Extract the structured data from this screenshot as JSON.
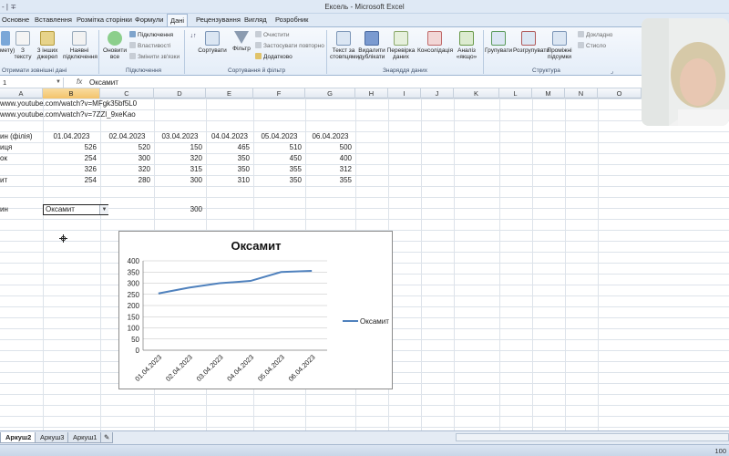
{
  "window": {
    "title": "Ексель - Microsoft Excel",
    "qat": "- | ∓"
  },
  "tabs": [
    "Основне",
    "Вставлення",
    "Розмітка сторінки",
    "Формули",
    "Дані",
    "Рецензування",
    "Вигляд",
    "Розробник"
  ],
  "ribbon": {
    "get_external": {
      "item1": "мету)",
      "item2": "З тексту",
      "item3": "З інших джерел",
      "label": "Отримати зовнішні дані"
    },
    "existing": {
      "label": "Наявні підключення"
    },
    "connections": {
      "refresh": "Оновити все",
      "connections": "Підключення",
      "properties": "Властивості",
      "edit_links": "Змінити зв'язки",
      "label": "Підключення"
    },
    "sort_filter": {
      "sort": "Сортувати",
      "filter": "Фільтр",
      "clear": "Очистити",
      "reapply": "Застосувати повторно",
      "advanced": "Додатково",
      "label": "Сортування й фільтр"
    },
    "data_tools": {
      "text_to_columns": "Текст за стовпцями",
      "remove_dup": "Видалити дублікати",
      "validation": "Перевірка даних",
      "consolidate": "Консолідація",
      "whatif": "Аналіз «якщо»",
      "label": "Знаряддя даних"
    },
    "outline": {
      "group": "Групувати",
      "ungroup": "Розгрупувати",
      "subtotal": "Проміжні підсумки",
      "show_detail": "Докладно",
      "hide_detail": "Стисло",
      "label": "Структура"
    }
  },
  "formula_bar": {
    "name_box": "1",
    "fx": "fx",
    "content": "Оксамит"
  },
  "columns": [
    "A",
    "B",
    "C",
    "D",
    "E",
    "F",
    "G",
    "H",
    "I",
    "J",
    "K",
    "L",
    "M",
    "N",
    "O"
  ],
  "cells": {
    "url1": "www.youtube.com/watch?v=MFgk35bf5L0",
    "url2": "www.youtube.com/watch?v=7ZZl_9xeKao",
    "header_label": "ин (філія)",
    "dates": [
      "01.04.2023",
      "02.04.2023",
      "03.04.2023",
      "04.04.2023",
      "05.04.2023",
      "06.04.2023"
    ],
    "rows": [
      {
        "label": "иця",
        "values": [
          526,
          520,
          150,
          465,
          510,
          500
        ]
      },
      {
        "label": "ок",
        "values": [
          254,
          300,
          320,
          350,
          450,
          400
        ]
      },
      {
        "label": "",
        "values": [
          326,
          320,
          315,
          350,
          355,
          312
        ]
      },
      {
        "label": "ит",
        "values": [
          254,
          280,
          300,
          310,
          350,
          355
        ]
      }
    ],
    "lookup_label": "ин",
    "dropdown_value": "Оксамит",
    "lookup_result": "300"
  },
  "chart_data": {
    "type": "line",
    "title": "Оксамит",
    "categories": [
      "01.04.2023",
      "02.04.2023",
      "03.04.2023",
      "04.04.2023",
      "05.04.2023",
      "06.04.2023"
    ],
    "series": [
      {
        "name": "Оксамит",
        "values": [
          254,
          280,
          300,
          310,
          350,
          355
        ]
      }
    ],
    "ylim": [
      0,
      400
    ],
    "yticks": [
      0,
      50,
      100,
      150,
      200,
      250,
      300,
      350,
      400
    ],
    "grid": true,
    "legend": "right",
    "colors": {
      "line": "#4f81bd",
      "grid": "#bfbfbf"
    }
  },
  "sheets": [
    "Аркуш2",
    "Аркуш3",
    "Аркуш1"
  ],
  "status": {
    "zoom": "100"
  },
  "colors": {
    "accent": "#f3c36b",
    "ribbon": "#dfe9f5"
  }
}
